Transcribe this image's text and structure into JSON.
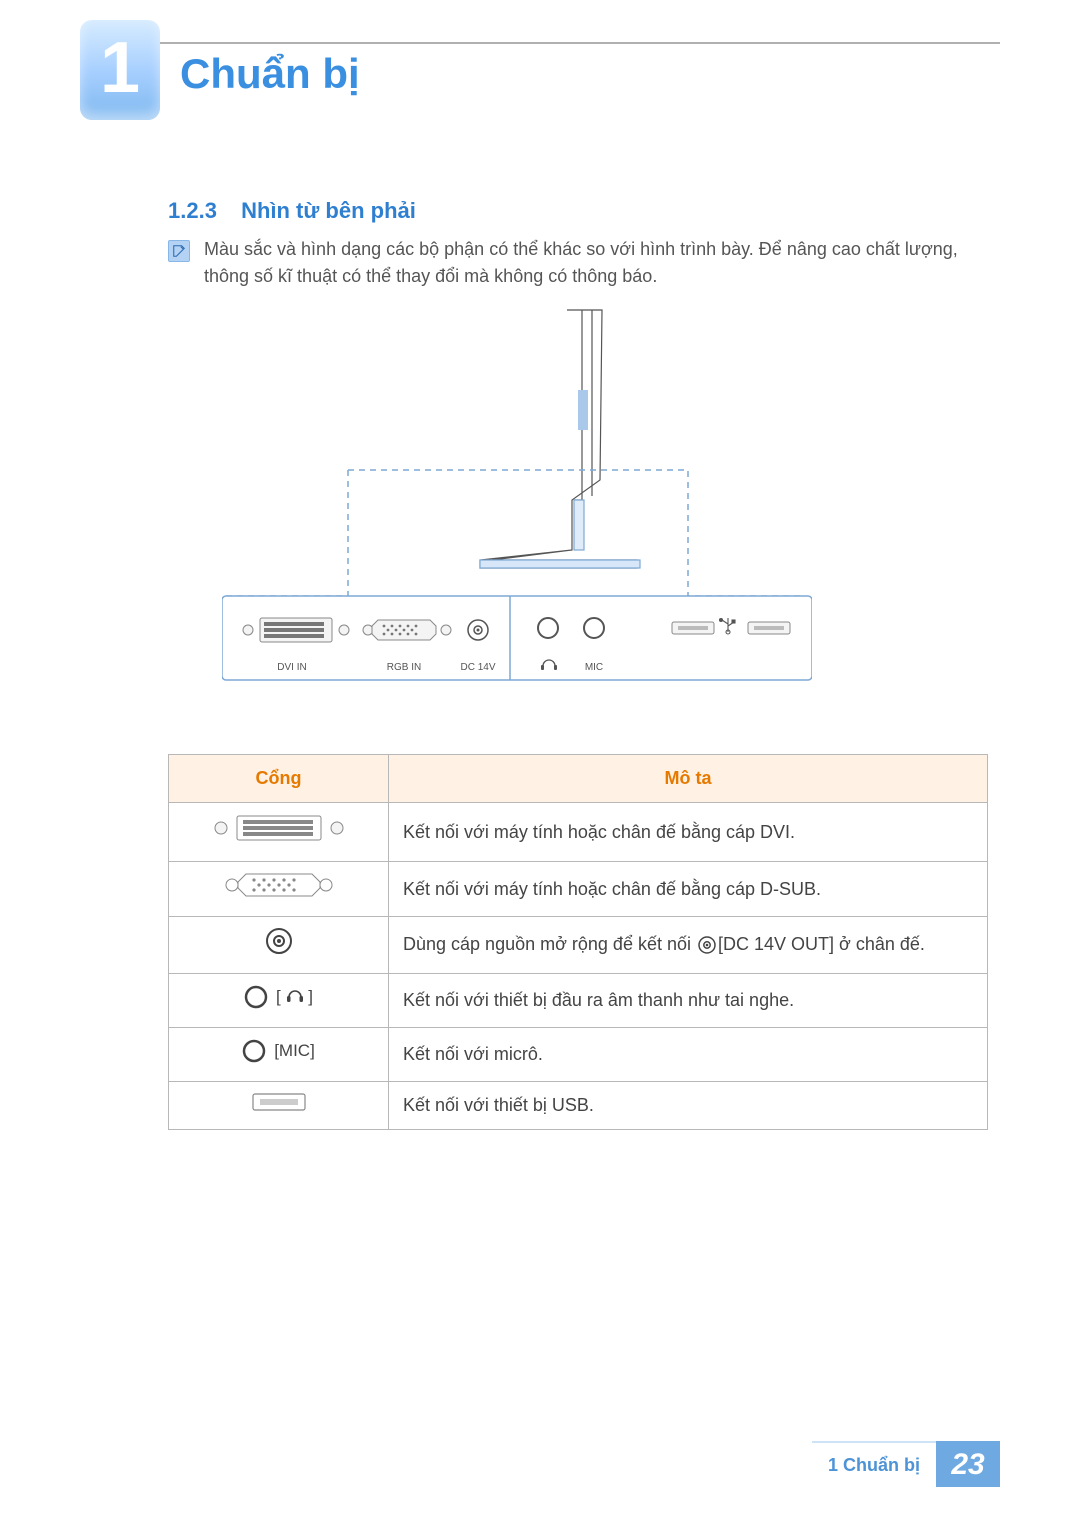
{
  "chapter": {
    "number": "1",
    "title": "Chuẩn bị"
  },
  "section": {
    "number": "1.2.3",
    "title": "Nhìn từ bên phải"
  },
  "note": "Màu sắc và hình dạng các bộ phận có thể khác so với hình trình bày. Để nâng cao chất lượng, thông số kĩ thuật có thể thay đổi mà không có thông báo.",
  "diagram_labels": {
    "dvi_in": "DVI IN",
    "rgb_in": "RGB IN",
    "dc_14v": "DC 14V",
    "mic": "MIC"
  },
  "table": {
    "headers": {
      "port": "Cổng",
      "desc": "Mô ta"
    },
    "rows": [
      {
        "icon": "dvi",
        "label": "",
        "desc": "Kết nối với máy tính hoặc chân đế bằng cáp DVI."
      },
      {
        "icon": "dsub",
        "label": "",
        "desc": "Kết nối với máy tính hoặc chân đế bằng cáp D-SUB."
      },
      {
        "icon": "dc",
        "label": "",
        "desc_pre": "Dùng cáp nguồn mở rộng để kết nối ",
        "desc_post": "[DC 14V OUT] ở chân đế."
      },
      {
        "icon": "jack-hp",
        "label": "[      ]",
        "desc": "Kết nối với thiết bị đầu ra âm thanh như tai nghe."
      },
      {
        "icon": "jack-mic",
        "label": "[MIC]",
        "desc": "Kết nối với micrô."
      },
      {
        "icon": "usb",
        "label": "",
        "desc": "Kết nối với thiết bị USB."
      }
    ]
  },
  "footer": {
    "label": "1 Chuẩn bị",
    "page": "23"
  }
}
